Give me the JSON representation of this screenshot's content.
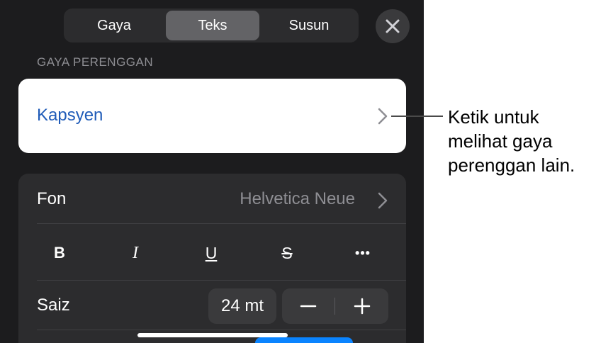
{
  "tabs": [
    {
      "label": "Gaya",
      "active": false
    },
    {
      "label": "Teks",
      "active": true
    },
    {
      "label": "Susun",
      "active": false
    }
  ],
  "section_header": "GAYA PERENGGAN",
  "paragraph_style": {
    "value": "Kapsyen"
  },
  "font": {
    "label": "Fon",
    "value": "Helvetica Neue"
  },
  "format_buttons": [
    "B",
    "I",
    "U",
    "S",
    "•••"
  ],
  "size": {
    "label": "Saiz",
    "value": "24 mt"
  },
  "callout": {
    "lines": [
      "Ketik untuk",
      "melihat gaya",
      "perenggan lain."
    ]
  },
  "colors": {
    "panel_bg": "#1c1c1e",
    "accent": "#0a84ff",
    "style_text": "#1f5bb8"
  },
  "icons": [
    "close-icon",
    "chevron-right-icon",
    "minus-icon",
    "plus-icon"
  ]
}
